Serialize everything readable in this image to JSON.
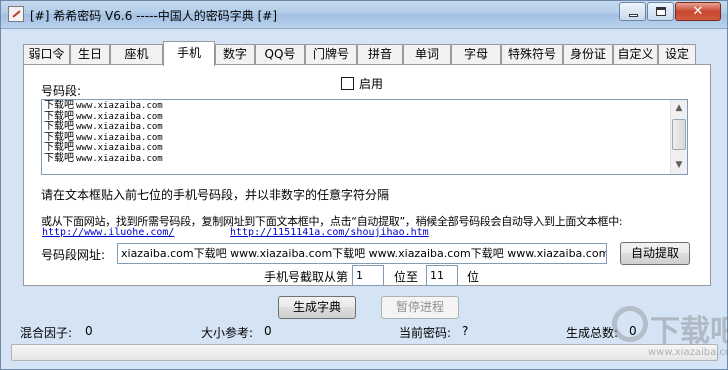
{
  "window": {
    "title": "[#] 希希密码 V6.6 -----中国人的密码字典 [#]"
  },
  "tabs": [
    {
      "label": "弱口令",
      "active": false
    },
    {
      "label": "生日",
      "active": false
    },
    {
      "label": "座机",
      "active": false
    },
    {
      "label": "手机",
      "active": true
    },
    {
      "label": "数字",
      "active": false
    },
    {
      "label": "QQ号",
      "active": false
    },
    {
      "label": "门牌号",
      "active": false
    },
    {
      "label": "拼音",
      "active": false
    },
    {
      "label": "单词",
      "active": false
    },
    {
      "label": "字母",
      "active": false
    },
    {
      "label": "特殊符号",
      "active": false
    },
    {
      "label": "身份证",
      "active": false
    },
    {
      "label": "自定义",
      "active": false
    },
    {
      "label": "设定",
      "active": false
    }
  ],
  "panel": {
    "segment_label": "号码段:",
    "enable_label": "启用",
    "enable_checked": false,
    "textarea_lines": [
      {
        "prefix": "下载吧",
        "url": "www.xiazaiba.com"
      },
      {
        "prefix": "下载吧",
        "url": "www.xiazaiba.com"
      },
      {
        "prefix": "下载吧",
        "url": "www.xiazaiba.com"
      },
      {
        "prefix": "下载吧",
        "url": "www.xiazaiba.com"
      },
      {
        "prefix": "下载吧",
        "url": "www.xiazaiba.com"
      },
      {
        "prefix": "下载吧",
        "url": "www.xiazaiba.com"
      }
    ],
    "instruction": "请在文本框贴入前七位的手机号码段，并以非数字的任意字符分隔",
    "web_instruction": "或从下面网站，找到所需号码段，复制网址到下面文本框中，点击“自动提取”，稍候全部号码段会自动导入到上面文本框中:",
    "link1": "http://www.iluohe.com/",
    "link2": "http://1151141a.com/shoujihao.htm",
    "url_label": "号码段网址:",
    "url_value": "xiazaiba.com下载吧 www.xiazaiba.com下载吧 www.xiazaiba.com下载吧 www.xiazaiba.com",
    "auto_extract_label": "自动提取",
    "cut_prefix": "手机号截取从第",
    "cut_from": "1",
    "cut_middle": "位至",
    "cut_to": "11",
    "cut_suffix": "位"
  },
  "actions": {
    "generate_label": "生成字典",
    "pause_label": "暂停进程"
  },
  "status": {
    "mix_factor_label": "混合因子:",
    "mix_factor_value": "0",
    "size_ref_label": "大小参考:",
    "size_ref_value": "0",
    "current_pwd_label": "当前密码:",
    "current_pwd_value": "?",
    "total_label": "生成总数:",
    "total_value": "0"
  },
  "progress_percent": 0,
  "watermark": {
    "text": "下载吧",
    "sub": "www.xiazaiba.com"
  }
}
